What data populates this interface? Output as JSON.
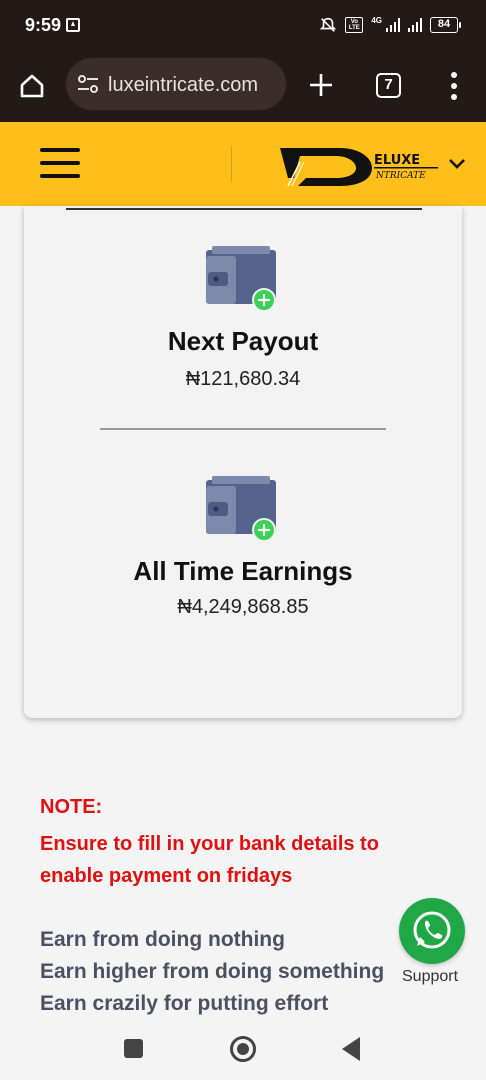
{
  "status_bar": {
    "time": "9:59",
    "network": "4G",
    "volte": "Vo LTE",
    "battery": "84"
  },
  "browser": {
    "url": "luxeintricate.com",
    "tab_count": "7"
  },
  "site": {
    "logo_text": "ELUXE",
    "logo_subtext": "NTRICATE"
  },
  "card": {
    "next_payout_title": "Next Payout",
    "next_payout_value": "₦121,680.34",
    "all_time_title": "All Time Earnings",
    "all_time_value": "₦4,249,868.85"
  },
  "note": {
    "heading": "NOTE:",
    "body": "Ensure to fill in your bank details to enable payment on fridays"
  },
  "taglines": [
    "Earn from doing nothing",
    "Earn higher from doing something",
    "Earn crazily for putting effort"
  ],
  "support": {
    "label": "Support"
  },
  "icons": {
    "home": "home-icon",
    "tune": "site-settings-icon",
    "new_tab": "plus-icon",
    "menu": "more-vert-icon",
    "hamburger": "hamburger-menu-icon",
    "wallet": "wallet-add-icon",
    "whatsapp": "whatsapp-icon"
  },
  "colors": {
    "header": "#ffbf1a",
    "browser_bar": "#231a18",
    "note": "#e01010",
    "whatsapp": "#1fa845"
  }
}
